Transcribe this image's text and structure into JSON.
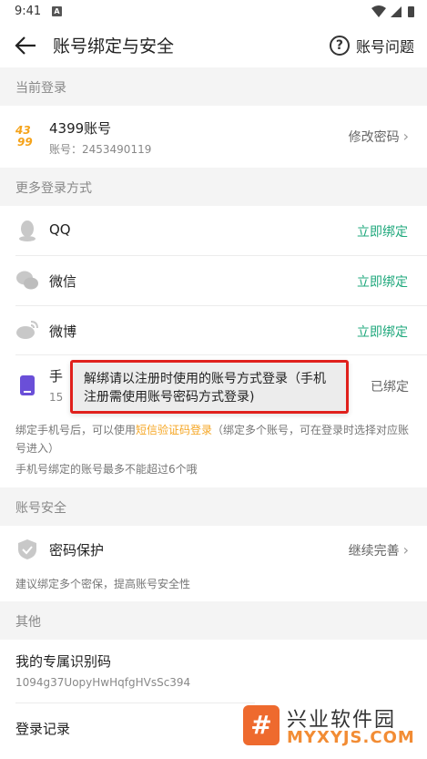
{
  "status_bar": {
    "time": "9:41",
    "notification_letter": "A"
  },
  "header": {
    "title": "账号绑定与安全",
    "help_label": "账号问题"
  },
  "current_login": {
    "section_title": "当前登录",
    "account_name": "4399账号",
    "account_id": "账号：2453490119",
    "action": "修改密码",
    "logo_top": "43",
    "logo_bottom": "99"
  },
  "more_login": {
    "section_title": "更多登录方式",
    "items": [
      {
        "label": "QQ",
        "action": "立即绑定"
      },
      {
        "label": "微信",
        "action": "立即绑定"
      },
      {
        "label": "微博",
        "action": "立即绑定"
      }
    ],
    "phone": {
      "label": "手",
      "sub": "15",
      "action": "已绑定"
    },
    "note_prefix": "绑定手机号后，可以使用",
    "note_link": "短信验证码登录",
    "note_suffix": "（绑定多个账号，可在登录时选择对应账号进入）",
    "note_line2": "手机号绑定的账号最多不能超过6个哦"
  },
  "toast": {
    "text": "解绑请以注册时使用的账号方式登录（手机注册需使用账号密码方式登录)"
  },
  "account_security": {
    "section_title": "账号安全",
    "item_label": "密码保护",
    "item_action": "继续完善",
    "note": "建议绑定多个密保，提高账号安全性"
  },
  "other": {
    "section_title": "其他",
    "id_label": "我的专属识别码",
    "id_value": "1094g37UopyHwHqfgHVsSc394",
    "login_record": "登录记录"
  },
  "watermark": {
    "logo": "#",
    "title": "兴业软件园",
    "url": "MYXYJS.COM"
  },
  "colors": {
    "accent_green": "#1fa87c",
    "link_orange": "#f5a623",
    "toast_border": "#e0201c",
    "phone_purple": "#6a4fd8"
  }
}
